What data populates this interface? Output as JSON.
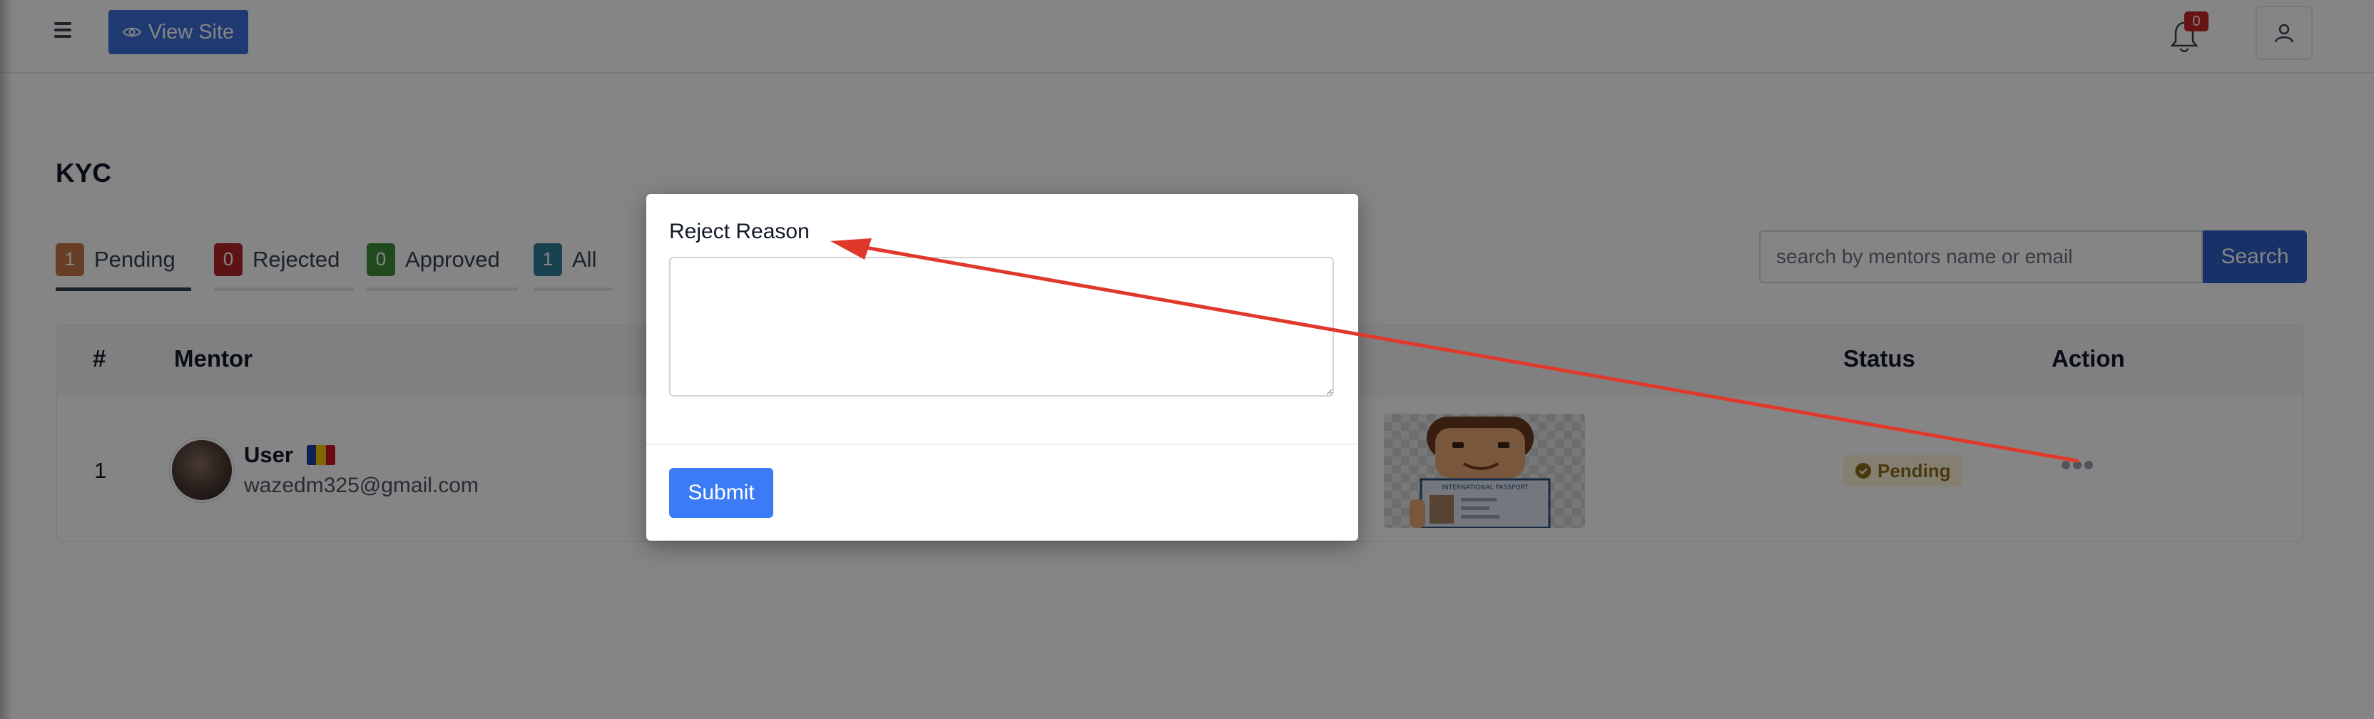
{
  "topbar": {
    "view_site_label": "View Site",
    "notification_count": "0"
  },
  "page": {
    "title": "KYC"
  },
  "tabs": [
    {
      "count": "1",
      "label": "Pending",
      "color": "#c77a4a"
    },
    {
      "count": "0",
      "label": "Rejected",
      "color": "#b3262a"
    },
    {
      "count": "0",
      "label": "Approved",
      "color": "#3f8f3a"
    },
    {
      "count": "1",
      "label": "All",
      "color": "#2f7f9a"
    }
  ],
  "search": {
    "placeholder": "search by mentors name or email",
    "button_label": "Search"
  },
  "table": {
    "columns": [
      "#",
      "Mentor",
      "Status",
      "Action"
    ],
    "rows": [
      {
        "index": "1",
        "name": "User",
        "email": "wazedm325@gmail.com",
        "status": "Pending",
        "passport_caption": "INTERNATIONAL PASSPORT"
      }
    ]
  },
  "modal": {
    "label": "Reject Reason",
    "textarea_value": "",
    "submit_label": "Submit"
  },
  "colors": {
    "primary": "#3b6fd8",
    "submit": "#3b7bf5",
    "arrow": "#e0392b",
    "pending_bg": "#fdf3d7",
    "pending_text": "#8a6d1c"
  },
  "icons": {
    "menu": "menu-icon",
    "view_site": "eye-icon",
    "notifications": "bell-icon",
    "user": "user-icon",
    "status": "check-circle-icon",
    "action": "more-horizontal-icon"
  }
}
